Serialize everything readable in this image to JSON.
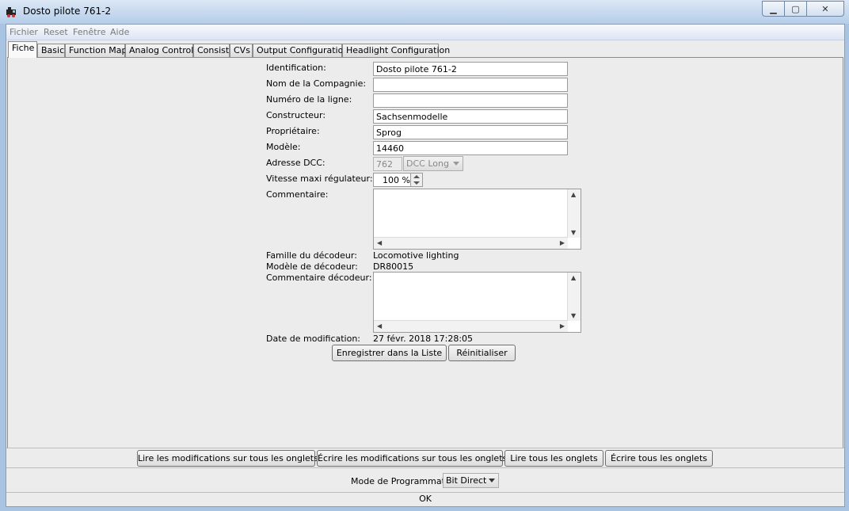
{
  "window": {
    "title": "Dosto pilote 761-2"
  },
  "menu": [
    "Fichier",
    "Reset",
    "Fenêtre",
    "Aide"
  ],
  "tabs": [
    "Fiche",
    "Basic",
    "Function Map",
    "Analog Controls",
    "Consist",
    "CVs",
    "Output Configuration",
    "Headlight Configuration"
  ],
  "form": {
    "identification_label": "Identification:",
    "identification_value": "Dosto pilote 761-2",
    "company_label": "Nom de la Compagnie:",
    "company_value": "",
    "line_label": "Numéro de la ligne:",
    "line_value": "",
    "builder_label": "Constructeur:",
    "builder_value": "Sachsenmodelle",
    "owner_label": "Propriétaire:",
    "owner_value": "Sprog",
    "model_label": "Modèle:",
    "model_value": "14460",
    "dcc_label": "Adresse DCC:",
    "dcc_value": "762",
    "dcc_type": "DCC Long",
    "speed_label": "Vitesse maxi régulateur:",
    "speed_value": "100 %",
    "comment_label": "Commentaire:",
    "family_label": "Famille du décodeur:",
    "family_value": "Locomotive lighting",
    "decoder_model_label": "Modèle de décodeur:",
    "decoder_model_value": "DR80015",
    "decoder_comment_label": "Commentaire décodeur:",
    "date_label": "Date de modification:",
    "date_value": "27 févr. 2018 17:28:05",
    "save_button": "Enregistrer dans la Liste",
    "reset_button": "Réinitialiser"
  },
  "actions": {
    "read_changes": "Lire les modifications sur tous les onglets",
    "write_changes": "Écrire les modifications sur tous les onglets",
    "read_all": "Lire tous les onglets",
    "write_all": "Écrire tous les onglets"
  },
  "programming": {
    "label": "Mode de Programmation",
    "mode": "Bit Direct"
  },
  "status": "OK"
}
